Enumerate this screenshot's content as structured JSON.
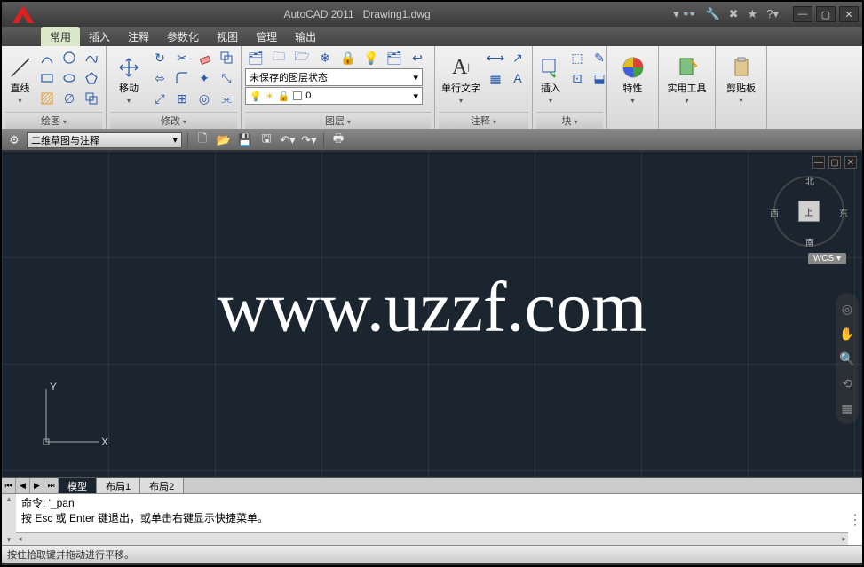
{
  "title": {
    "app": "AutoCAD 2011",
    "file": "Drawing1.dwg"
  },
  "menus": {
    "items": [
      "常用",
      "插入",
      "注释",
      "参数化",
      "视图",
      "管理",
      "输出"
    ],
    "active_index": 0
  },
  "ribbon": {
    "draw": {
      "label": "绘图",
      "line_btn": "直线"
    },
    "modify": {
      "label": "修改",
      "move_btn": "移动"
    },
    "layer": {
      "label": "图层",
      "combo_value": "未保存的图层状态"
    },
    "annotation": {
      "label": "注释",
      "text_btn": "单行文字"
    },
    "block": {
      "label": "块",
      "insert_btn": "插入"
    },
    "properties": {
      "label": "特性"
    },
    "utilities": {
      "label": "实用工具"
    },
    "clipboard": {
      "label": "剪贴板"
    }
  },
  "qat": {
    "workspace": "二维草图与注释"
  },
  "canvas": {
    "watermark": "www.uzzf.com",
    "wcs_label": "WCS",
    "axes": {
      "x": "X",
      "y": "Y"
    },
    "navcube": {
      "top": "上",
      "n": "北",
      "e": "东",
      "s": "南",
      "w": "西"
    }
  },
  "sheets": {
    "tabs": [
      "模型",
      "布局1",
      "布局2"
    ],
    "active_index": 0
  },
  "cmdline": {
    "line1": "命令: '_pan",
    "line2": "按 Esc 或 Enter 键退出，或单击右键显示快捷菜单。"
  },
  "statusbar": {
    "text": "按住拾取键并拖动进行平移。"
  }
}
